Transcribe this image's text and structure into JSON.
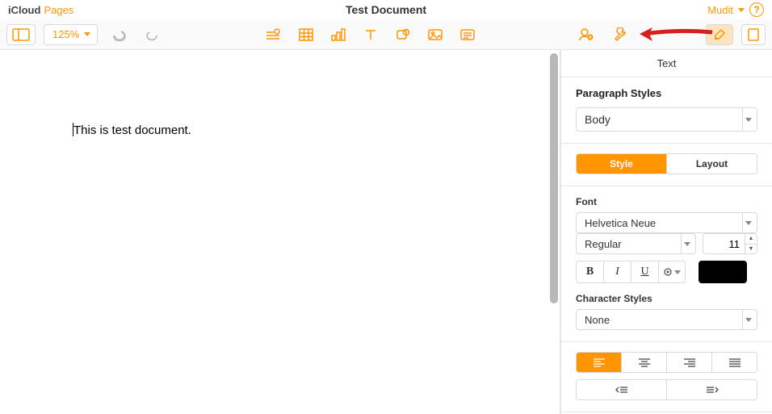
{
  "titlebar": {
    "brand1": "iCloud",
    "brand2": "Pages",
    "docTitle": "Test Document",
    "user": "Mudit",
    "help": "?"
  },
  "toolbar": {
    "zoom": "125%"
  },
  "document": {
    "text": "This is test document."
  },
  "sidebar": {
    "tab": "Text",
    "paragraphStylesLabel": "Paragraph Styles",
    "paragraphStyle": "Body",
    "segStyle": "Style",
    "segLayout": "Layout",
    "fontLabel": "Font",
    "fontFamily": "Helvetica Neue",
    "fontStyle": "Regular",
    "fontSize": "11",
    "bold": "B",
    "italic": "I",
    "underline": "U",
    "charStylesLabel": "Character Styles",
    "charStyle": "None"
  }
}
